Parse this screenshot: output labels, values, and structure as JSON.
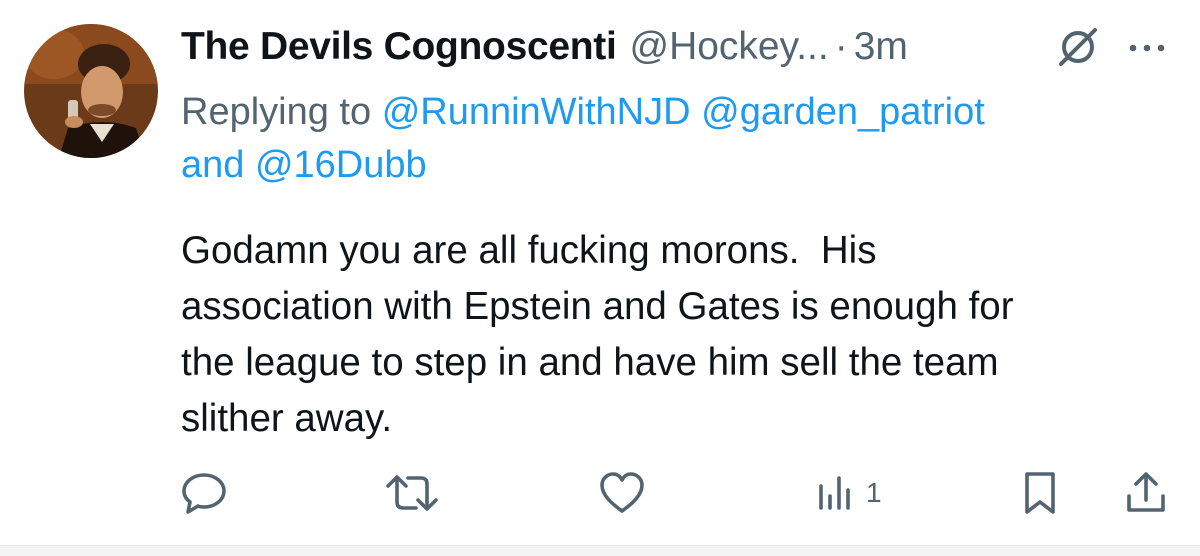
{
  "tweet": {
    "display_name": "The Devils Cognoscenti",
    "handle": "@Hockey...",
    "dot": "·",
    "time": "3m",
    "reply": {
      "prefix": "Replying to",
      "mention_1": "@RunninWithNJD",
      "mention_2": "@garden_patriot",
      "conjunction": "and",
      "mention_3": "@16Dubb"
    },
    "body_lines": [
      "Godamn you are all fucking morons.  His",
      "association with Epstein and Gates is enough for",
      "the league to step in and have him sell the team",
      "slither away."
    ]
  },
  "actions": {
    "reply_icon": "speech-bubble",
    "retweet_icon": "retweet-arrows",
    "like_icon": "heart",
    "views_icon": "bar-chart",
    "views_count": "1",
    "bookmark_icon": "bookmark",
    "share_icon": "share-upload"
  },
  "header_icons": {
    "grok": "slashed-circle",
    "more": "three-dots"
  },
  "colors": {
    "text": "#0f1419",
    "secondary": "#536471",
    "link": "#1d9bf0"
  }
}
